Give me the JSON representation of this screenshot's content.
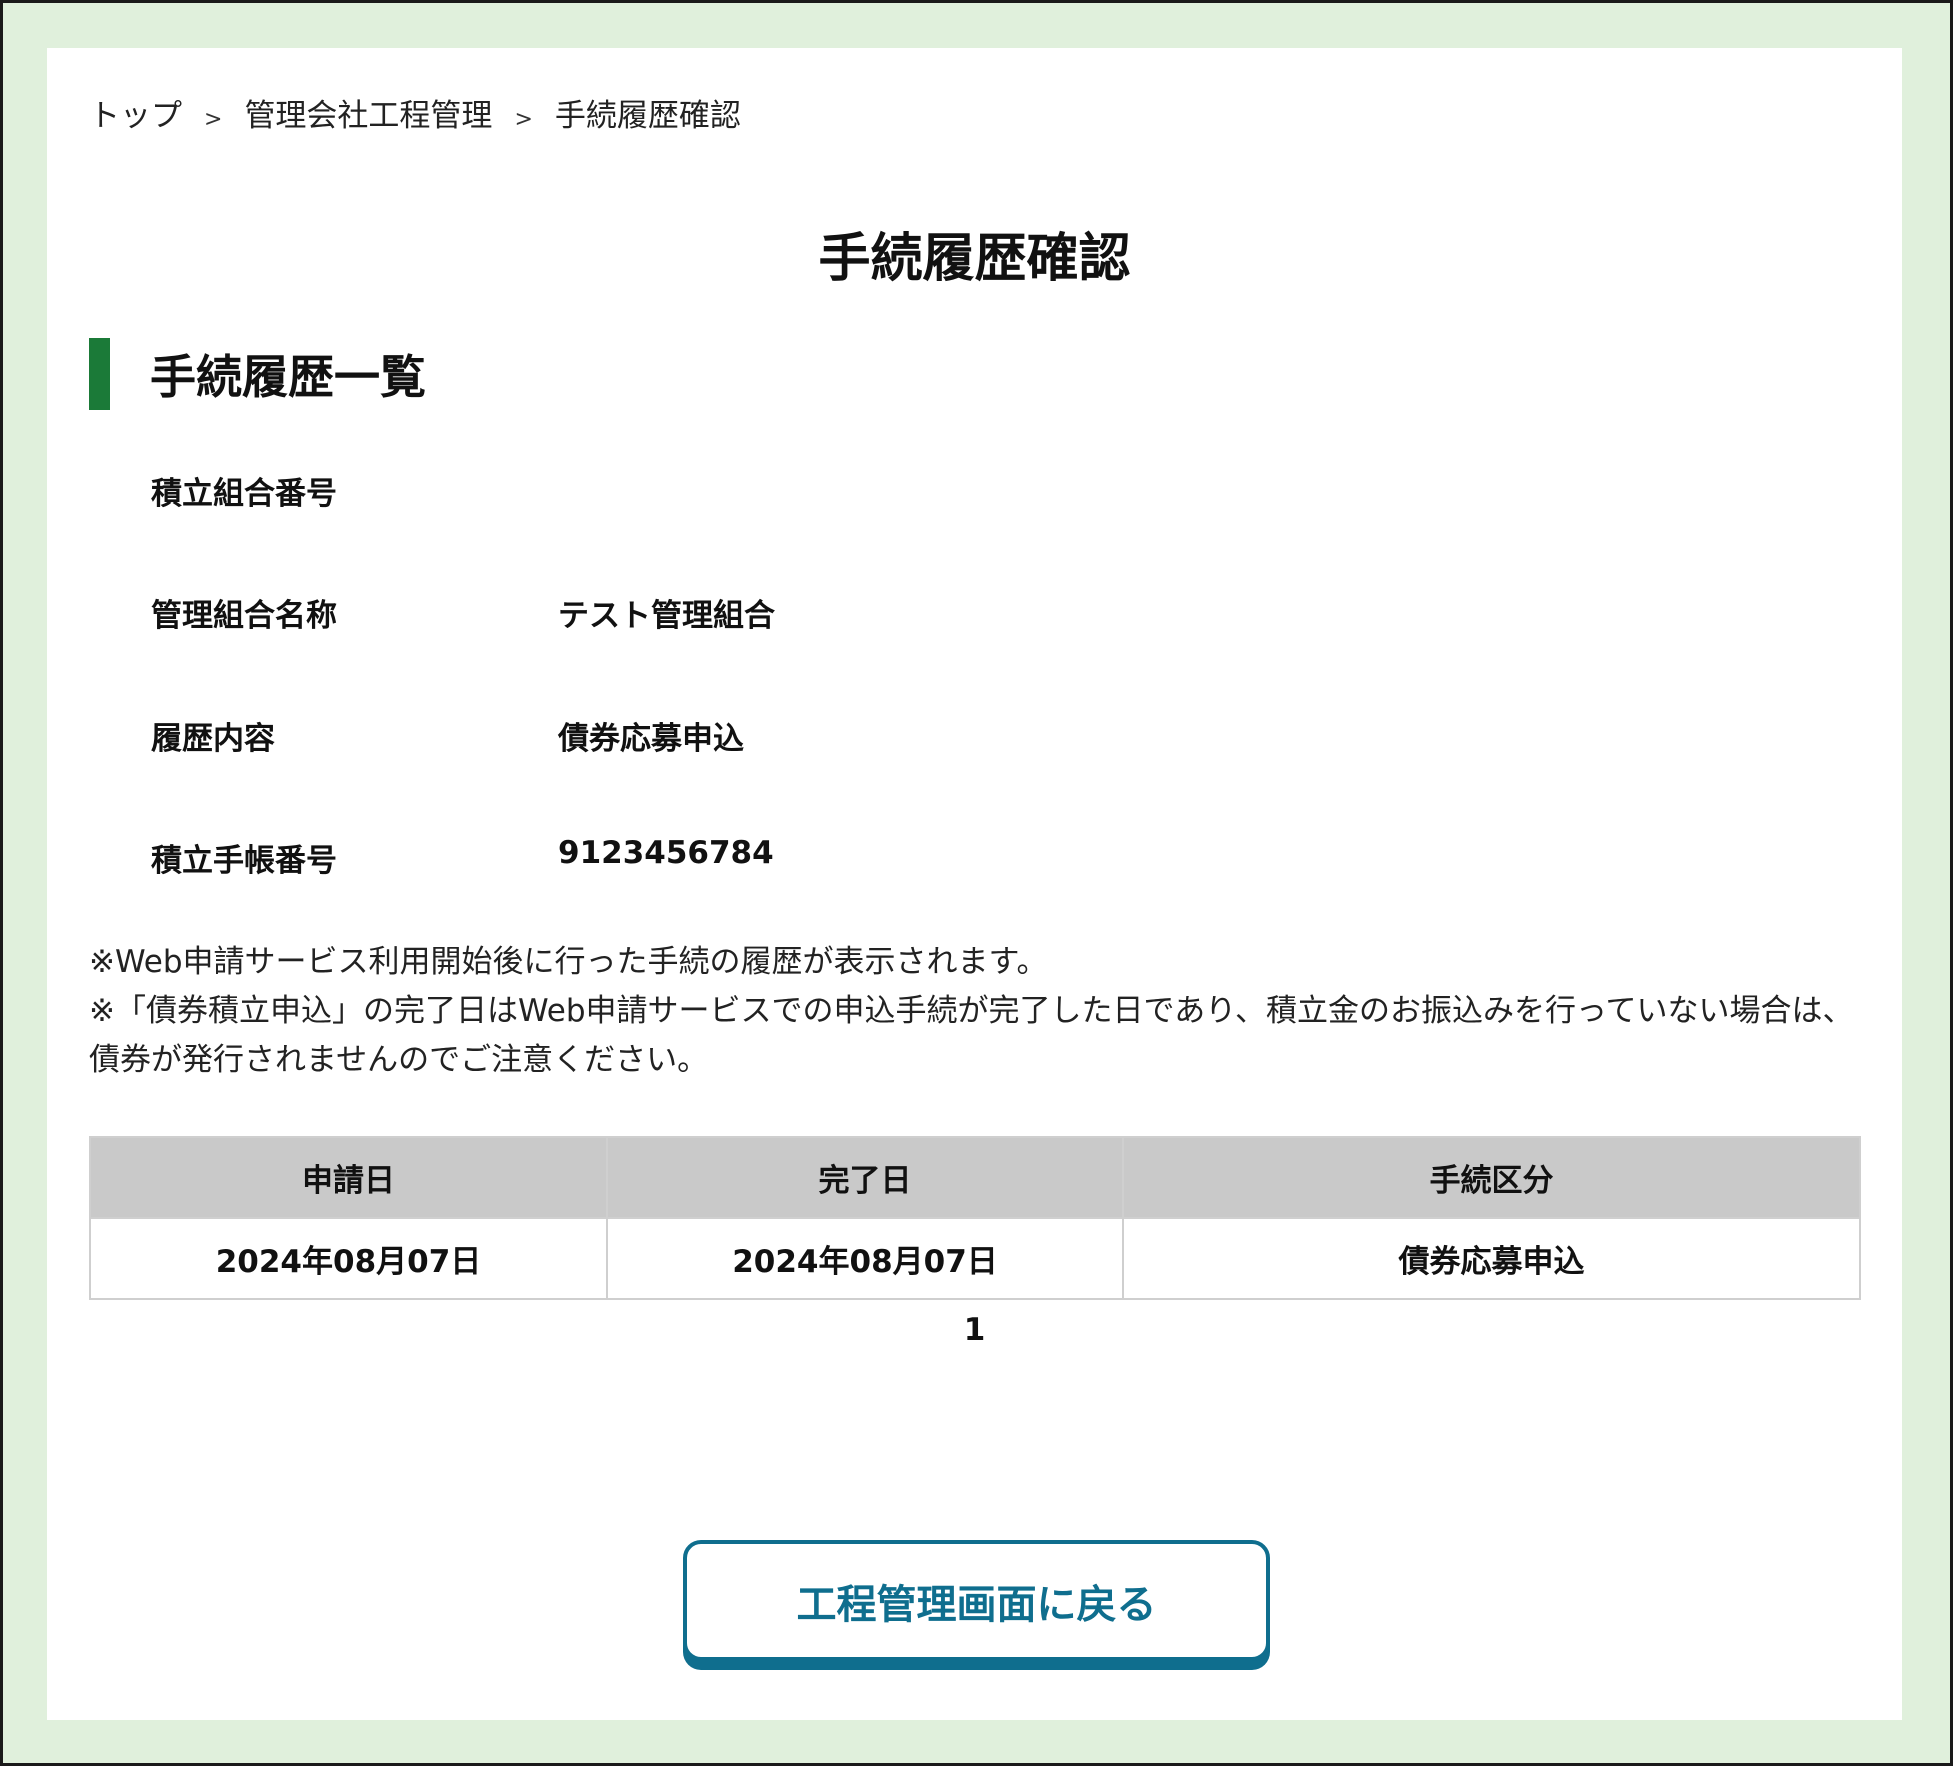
{
  "breadcrumb": {
    "items": [
      "トップ",
      "管理会社工程管理",
      "手続履歴確認"
    ],
    "separator": ">"
  },
  "page_title": "手続履歴確認",
  "section": {
    "title": "手続履歴一覧",
    "accent_color": "#1b7a38"
  },
  "fields": [
    {
      "label": "積立組合番号",
      "value": ""
    },
    {
      "label": "管理組合名称",
      "value": "テスト管理組合"
    },
    {
      "label": "履歴内容",
      "value": "債券応募申込"
    },
    {
      "label": "積立手帳番号",
      "value": "9123456784"
    }
  ],
  "notes": [
    "※Web申請サービス利用開始後に行った手続の履歴が表示されます。",
    "※「債券積立申込」の完了日はWeb申請サービスでの申込手続が完了した日であり、積立金のお振込みを行っていない場合は、債券が発行されませんのでご注意ください。"
  ],
  "table": {
    "headers": [
      "申請日",
      "完了日",
      "手続区分"
    ],
    "rows": [
      [
        "2024年08月07日",
        "2024年08月07日",
        "債券応募申込"
      ]
    ]
  },
  "pagination": {
    "current_page": "1"
  },
  "back_button": {
    "label": "工程管理画面に戻る",
    "color": "#0f6e8e"
  }
}
